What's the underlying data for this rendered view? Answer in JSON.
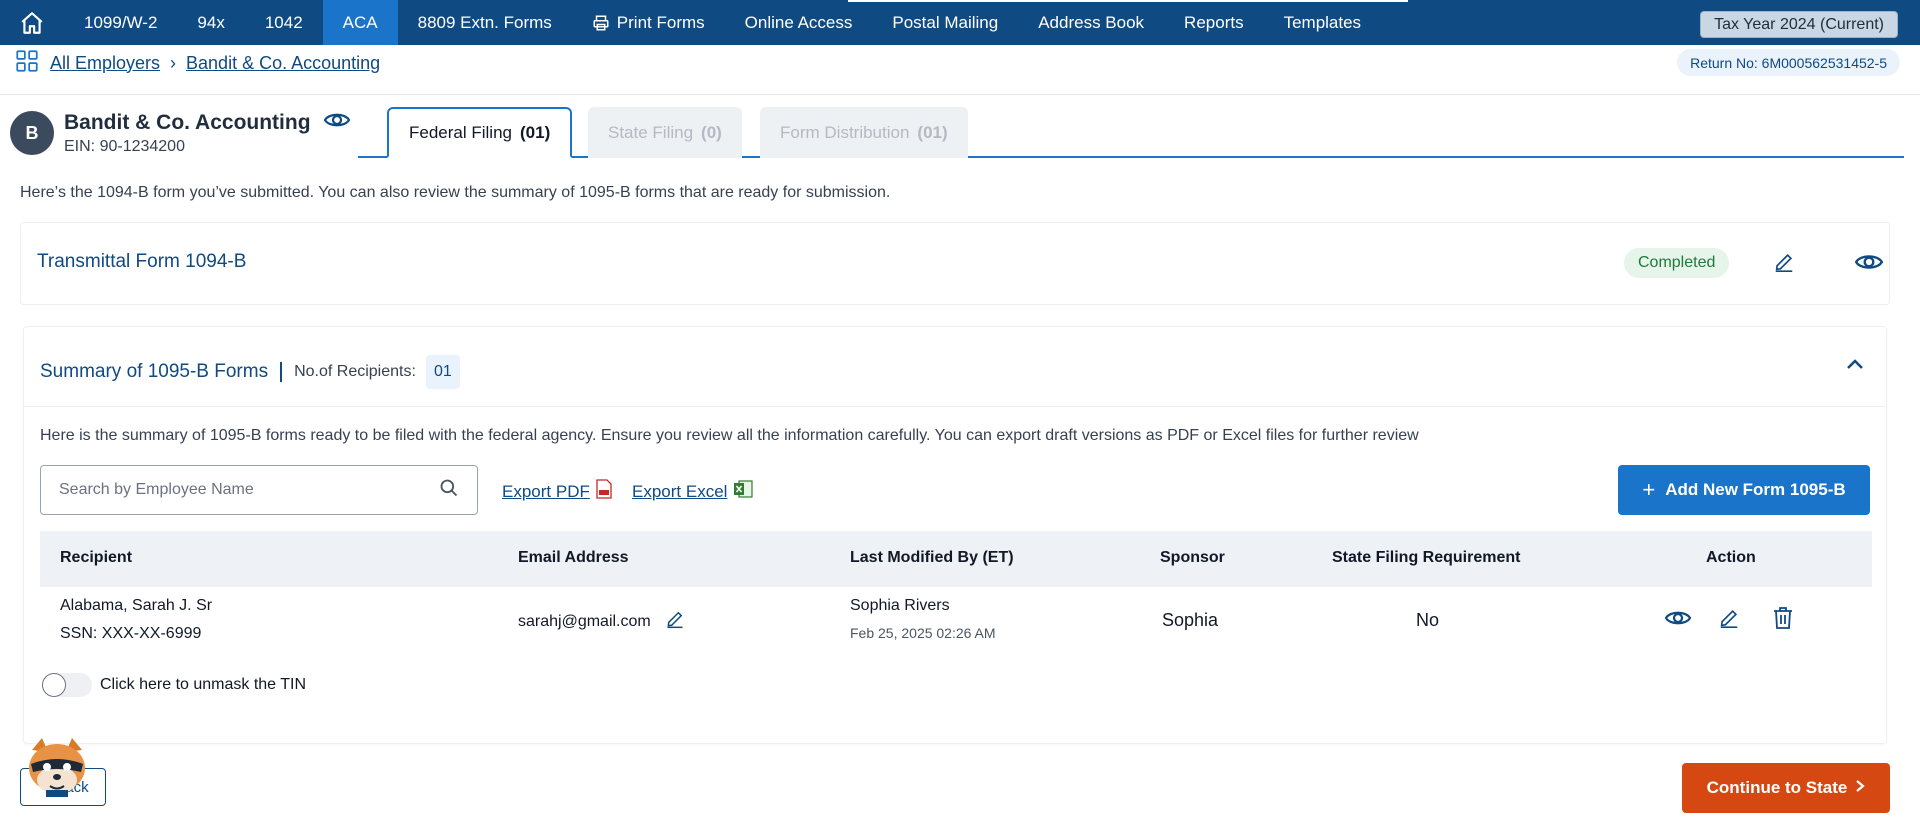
{
  "nav": {
    "items": [
      "1099/W-2",
      "94x",
      "1042",
      "ACA",
      "8809 Extn. Forms",
      "Print Forms",
      "Online Access",
      "Postal Mailing",
      "Address Book",
      "Reports",
      "Templates"
    ],
    "active": "ACA",
    "tax_year": "Tax Year 2024 (Current)"
  },
  "breadcrumb": {
    "all_employers": "All Employers",
    "current": "Bandit & Co. Accounting"
  },
  "return_no": "Return No: 6M000562531452-5",
  "employer": {
    "initial": "B",
    "name": "Bandit & Co. Accounting",
    "ein": "EIN: 90-1234200"
  },
  "tabs": [
    {
      "label": "Federal Filing",
      "count": "(01)"
    },
    {
      "label": "State Filing",
      "count": "(0)"
    },
    {
      "label": "Form Distribution",
      "count": "(01)"
    }
  ],
  "intro": "Here’s the 1094-B form you’ve submitted. You can also review the summary of 1095-B forms that are ready for submission.",
  "transmittal": {
    "title": "Transmittal Form 1094-B",
    "status": "Completed"
  },
  "summary": {
    "title": "Summary of 1095-B Forms",
    "recipients_label": "No.of Recipients:",
    "recipients_count": "01",
    "description": "Here is the summary of 1095-B forms ready to be filed with the federal agency. Ensure you review all the information carefully. You can export draft versions as PDF or Excel files for further review",
    "search_placeholder": "Search by Employee Name",
    "export_pdf": "Export PDF",
    "export_excel": "Export Excel",
    "add_button": "Add New Form 1095-B",
    "columns": [
      "Recipient",
      "Email Address",
      "Last Modified By (ET)",
      "Sponsor",
      "State Filing Requirement",
      "Action"
    ],
    "rows": [
      {
        "recipient": "Alabama, Sarah J. Sr",
        "ssn": "SSN: XXX-XX-6999",
        "email": "sarahj@gmail.com",
        "modified_by": "Sophia Rivers",
        "modified_at": "Feb 25, 2025 02:26 AM",
        "sponsor": "Sophia",
        "state_filing": "No"
      }
    ],
    "unmask_label": "Click here to unmask the TIN"
  },
  "footer": {
    "back": "Back",
    "continue": "Continue to State"
  },
  "colors": {
    "nav_bg": "#0f4a82",
    "accent": "#1a74c9",
    "continue": "#d64812",
    "completed": "#1e7a3a"
  }
}
